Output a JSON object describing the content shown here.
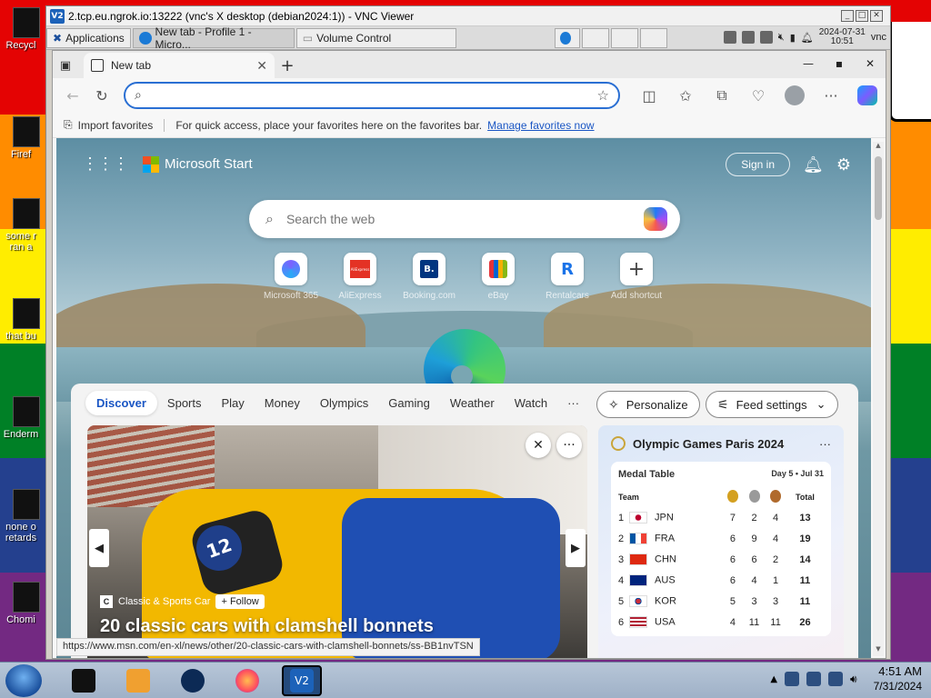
{
  "desktop": {
    "icons": [
      {
        "label": "Recycl"
      },
      {
        "label": "Firef"
      },
      {
        "label": "some r\nran a"
      },
      {
        "label": "that bu"
      },
      {
        "label": "Enderm"
      },
      {
        "label": "none o\nretards"
      },
      {
        "label": "Chomi"
      }
    ]
  },
  "vnc": {
    "logo": "V2",
    "title": "2.tcp.eu.ngrok.io:13222 (vnc's X desktop (debian2024:1)) - VNC Viewer",
    "remote_taskbar": {
      "items": [
        {
          "label": "Applications"
        },
        {
          "label": "New tab - Profile 1 - Micro..."
        },
        {
          "label": "Volume Control"
        }
      ],
      "clock_date": "2024-07-31",
      "clock_time": "10:51",
      "user": "vnc"
    }
  },
  "browser": {
    "tab_title": "New tab",
    "address_value": "",
    "favorites_bar": {
      "import_label": "Import favorites",
      "prompt": "For quick access, place your favorites here on the favorites bar.",
      "manage_link": "Manage favorites now"
    },
    "status_url": "https://www.msn.com/en-xl/news/other/20-classic-cars-with-clamshell-bonnets/ss-BB1nvTSN"
  },
  "ntp": {
    "brand": "Microsoft Start",
    "signin_label": "Sign in",
    "search_placeholder": "Search the web",
    "shortcuts": [
      {
        "label": "Microsoft 365",
        "icon": "microsoft-365-icon"
      },
      {
        "label": "AliExpress",
        "icon": "aliexpress-icon",
        "tile_text": "AliExpress"
      },
      {
        "label": "Booking.com",
        "icon": "booking-icon",
        "tile_text": "B."
      },
      {
        "label": "eBay",
        "icon": "ebay-icon"
      },
      {
        "label": "Rentalcars",
        "icon": "rentalcars-icon",
        "tile_text": "R"
      },
      {
        "label": "Add shortcut",
        "icon": "plus-icon",
        "tile_text": "+"
      }
    ]
  },
  "feed": {
    "nav": [
      "Discover",
      "Sports",
      "Play",
      "Money",
      "Olympics",
      "Gaming",
      "Weather",
      "Watch",
      "···"
    ],
    "personalize_label": "Personalize",
    "feed_settings_label": "Feed settings",
    "hero": {
      "source": "Classic & Sports Car",
      "follow_label": "+ Follow",
      "title": "20 classic cars with clamshell bonnets",
      "car_number": "12"
    },
    "olympics": {
      "title": "Olympic Games Paris 2024",
      "more": "···",
      "table_title": "Medal Table",
      "day": "Day 5 • Jul 31",
      "headers": {
        "team": "Team",
        "total": "Total"
      },
      "rows": [
        {
          "rank": "1",
          "team": "JPN",
          "gold": "7",
          "silver": "2",
          "bronze": "4",
          "total": "13"
        },
        {
          "rank": "2",
          "team": "FRA",
          "gold": "6",
          "silver": "9",
          "bronze": "4",
          "total": "19"
        },
        {
          "rank": "3",
          "team": "CHN",
          "gold": "6",
          "silver": "6",
          "bronze": "2",
          "total": "14"
        },
        {
          "rank": "4",
          "team": "AUS",
          "gold": "6",
          "silver": "4",
          "bronze": "1",
          "total": "11"
        },
        {
          "rank": "5",
          "team": "KOR",
          "gold": "5",
          "silver": "3",
          "bronze": "3",
          "total": "11"
        },
        {
          "rank": "6",
          "team": "USA",
          "gold": "4",
          "silver": "11",
          "bronze": "11",
          "total": "26"
        }
      ]
    }
  },
  "host_taskbar": {
    "time": "4:51 AM",
    "date": "7/31/2024"
  },
  "colors": {
    "accent": "#2a6fd3",
    "link": "#1a56c4",
    "gold": "#d4a020",
    "silver": "#9a9a9a",
    "bronze": "#b06a2c"
  }
}
